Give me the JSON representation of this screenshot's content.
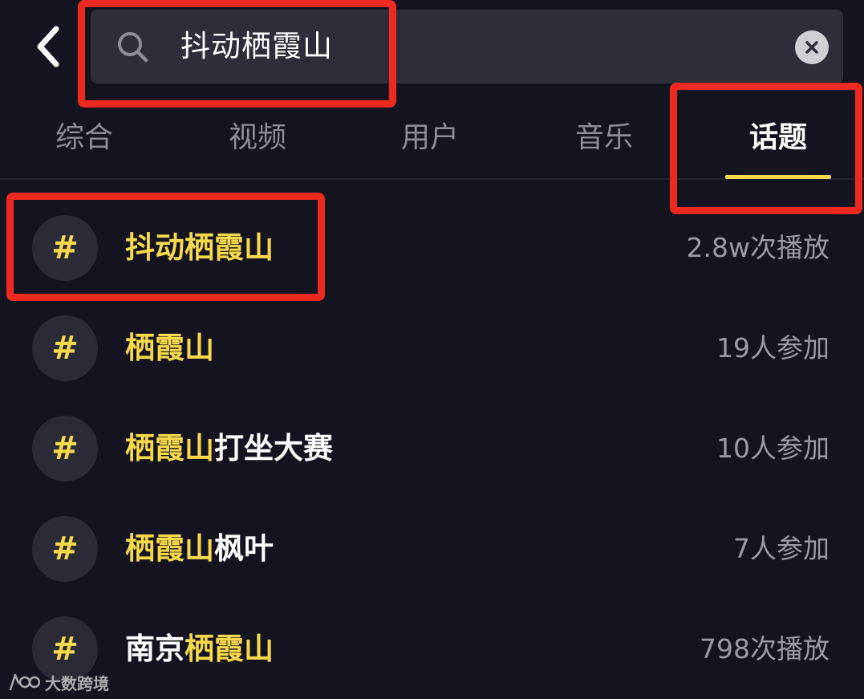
{
  "search": {
    "query": "抖动栖霞山"
  },
  "tabs": [
    {
      "label": "综合",
      "active": false
    },
    {
      "label": "视频",
      "active": false
    },
    {
      "label": "用户",
      "active": false
    },
    {
      "label": "音乐",
      "active": false
    },
    {
      "label": "话题",
      "active": true
    }
  ],
  "topics": [
    {
      "parts": [
        {
          "text": "抖动栖霞山",
          "highlight": true
        }
      ],
      "stat": "2.8w次播放"
    },
    {
      "parts": [
        {
          "text": "栖霞山",
          "highlight": true
        }
      ],
      "stat": "19人参加"
    },
    {
      "parts": [
        {
          "text": "栖霞山",
          "highlight": true
        },
        {
          "text": "打坐大赛",
          "highlight": false
        }
      ],
      "stat": "10人参加"
    },
    {
      "parts": [
        {
          "text": "栖霞山",
          "highlight": true
        },
        {
          "text": "枫叶",
          "highlight": false
        }
      ],
      "stat": "7人参加"
    },
    {
      "parts": [
        {
          "text": "南京",
          "highlight": false
        },
        {
          "text": "栖霞山",
          "highlight": true
        }
      ],
      "stat": "798次播放"
    }
  ],
  "hash_symbol": "#",
  "watermark": {
    "text": "大数跨境"
  },
  "icons": {
    "back": "chevron-left-icon",
    "search": "search-icon",
    "clear": "clear-circle-icon",
    "hash": "hashtag-icon"
  },
  "colors": {
    "background": "#141420",
    "search_bg": "#2e2e3a",
    "accent_yellow": "#f8d949",
    "annotation_red": "#ee2a20",
    "muted_text": "#8d8d97"
  }
}
